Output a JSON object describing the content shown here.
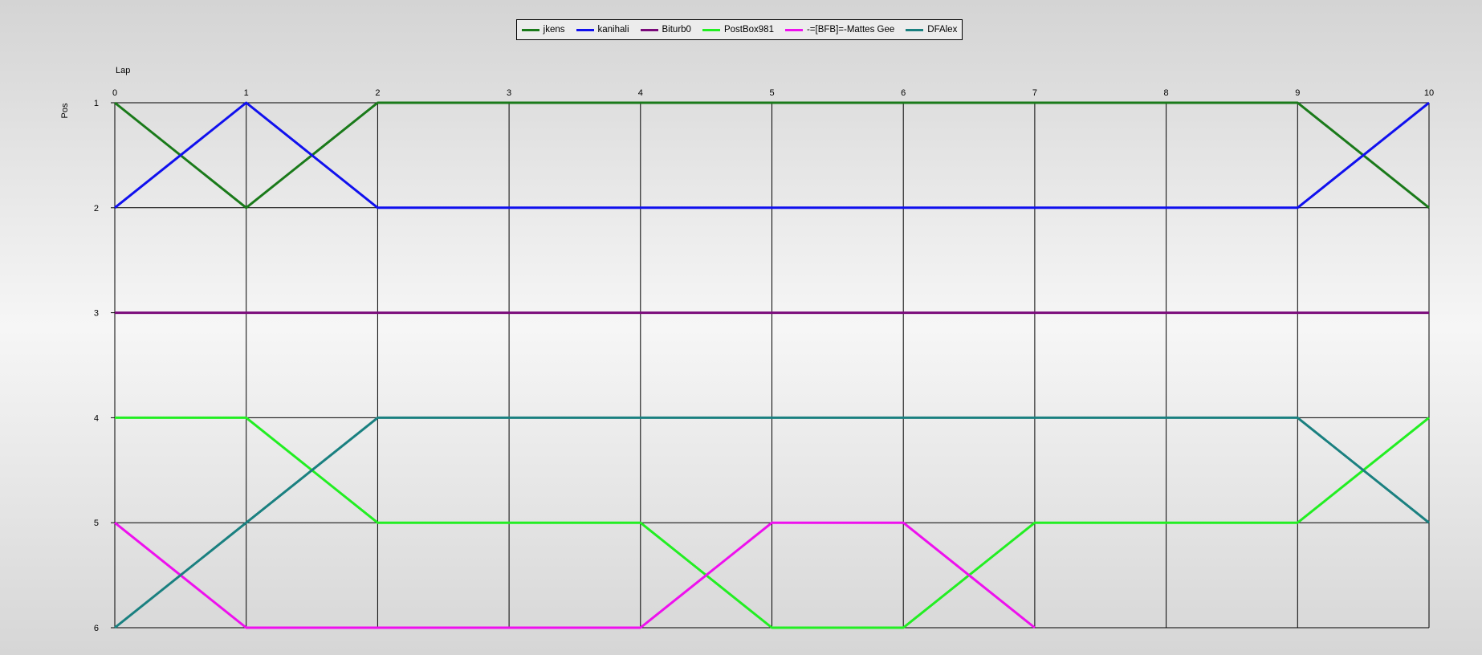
{
  "chart_data": {
    "type": "line",
    "title": "",
    "xlabel": "Lap",
    "ylabel": "Pos",
    "x": [
      0,
      1,
      2,
      3,
      4,
      5,
      6,
      7,
      8,
      9,
      10
    ],
    "x_ticks": [
      "0",
      "1",
      "2",
      "3",
      "4",
      "5",
      "6",
      "7",
      "8",
      "9",
      "10"
    ],
    "y_ticks": [
      "1",
      "2",
      "3",
      "4",
      "5",
      "6"
    ],
    "xlim": [
      0,
      10
    ],
    "ylim": [
      1,
      6
    ],
    "y_inverted": true,
    "grid": true,
    "legend_position": "top-center",
    "series": [
      {
        "name": "jkens",
        "color": "#1a7a1a",
        "values": [
          1,
          2,
          1,
          1,
          1,
          1,
          1,
          1,
          1,
          1,
          2
        ]
      },
      {
        "name": "kanihali",
        "color": "#1010ee",
        "values": [
          2,
          1,
          2,
          2,
          2,
          2,
          2,
          2,
          2,
          2,
          1
        ]
      },
      {
        "name": "Biturb0",
        "color": "#7a0a7a",
        "values": [
          3,
          3,
          3,
          3,
          3,
          3,
          3,
          3,
          3,
          3,
          3
        ]
      },
      {
        "name": "PostBox981",
        "color": "#22ee22",
        "values": [
          4,
          4,
          5,
          5,
          5,
          6,
          6,
          5,
          5,
          5,
          4
        ]
      },
      {
        "name": "-=[BFB]=-Mattes Gee",
        "color": "#ee10ee",
        "values": [
          5,
          6,
          6,
          6,
          6,
          5,
          5,
          6,
          null,
          null,
          null
        ]
      },
      {
        "name": "DFAlex",
        "color": "#1a8080",
        "values": [
          6,
          5,
          4,
          4,
          4,
          4,
          4,
          4,
          4,
          4,
          5
        ]
      }
    ]
  }
}
